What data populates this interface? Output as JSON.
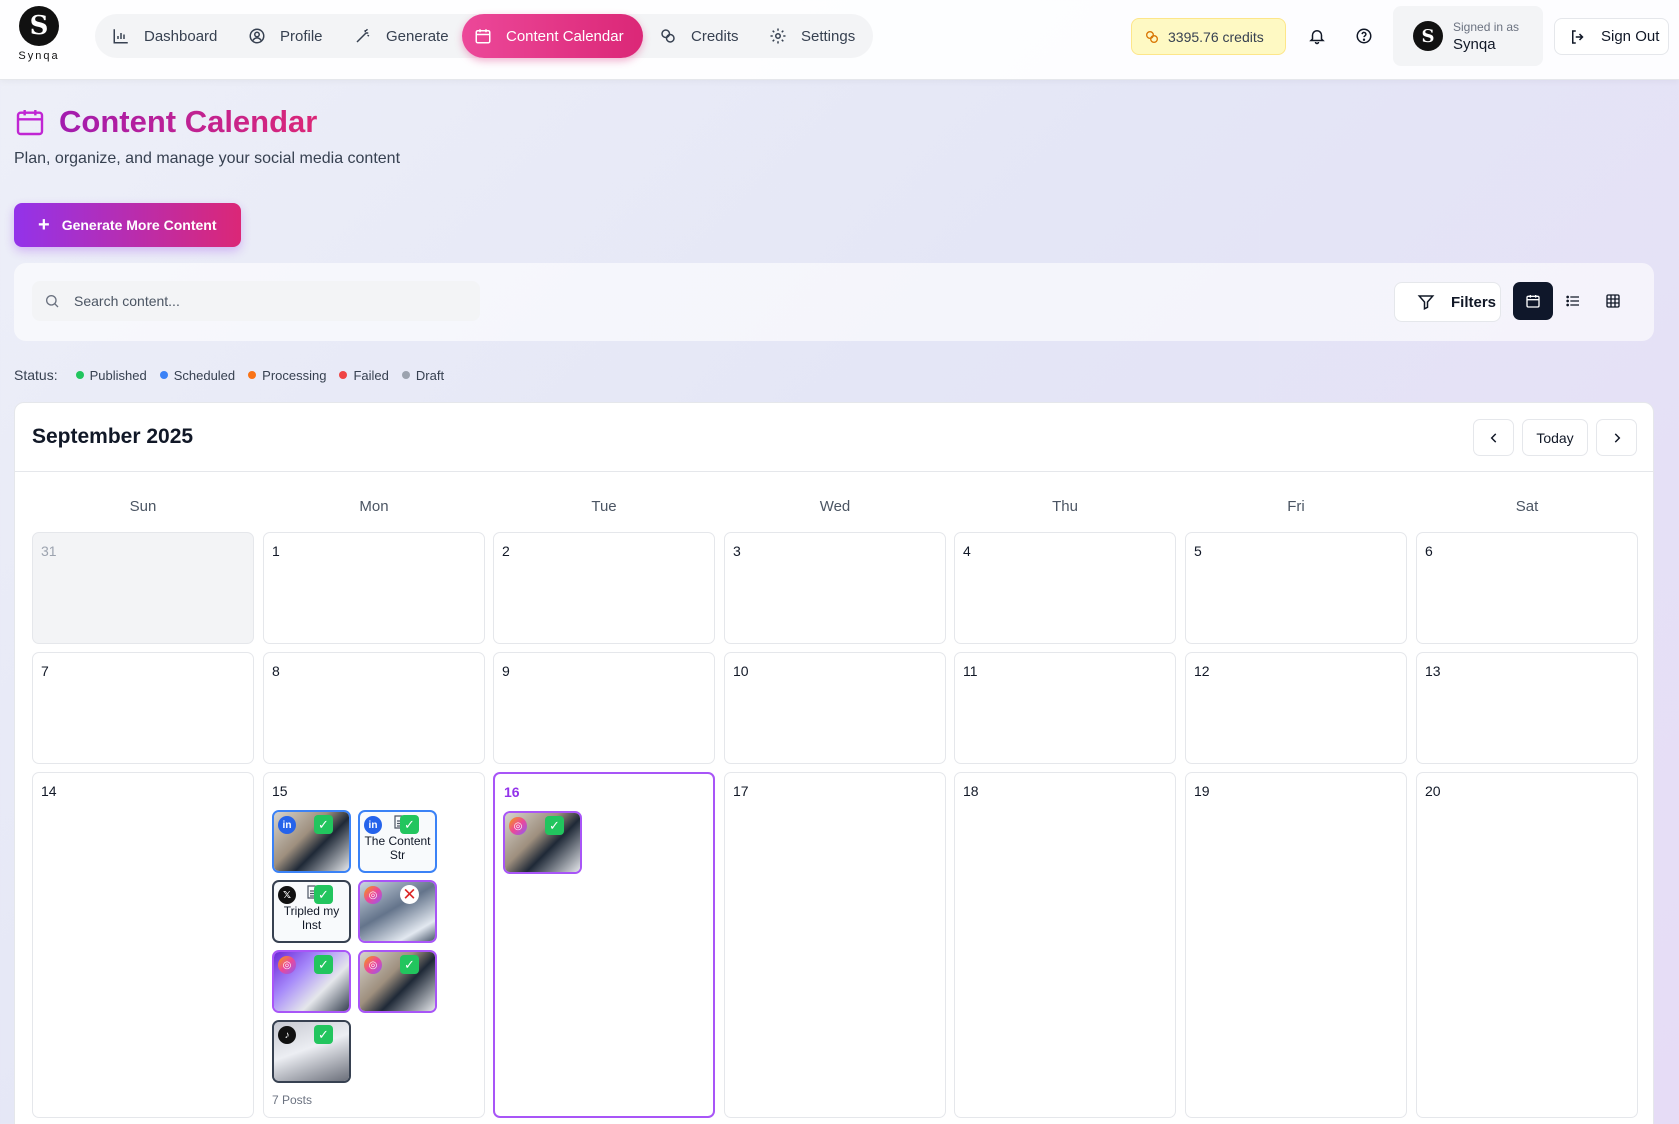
{
  "brand": {
    "name": "Synqa"
  },
  "nav": {
    "items": [
      {
        "label": "Dashboard",
        "icon": "bar-chart-icon"
      },
      {
        "label": "Profile",
        "icon": "user-circle-icon"
      },
      {
        "label": "Generate",
        "icon": "magic-wand-icon"
      },
      {
        "label": "Content Calendar",
        "icon": "calendar-icon",
        "active": true
      },
      {
        "label": "Credits",
        "icon": "coins-icon"
      },
      {
        "label": "Settings",
        "icon": "gear-icon"
      }
    ]
  },
  "header": {
    "credits": "3395.76 credits",
    "signed_in_label": "Signed in as",
    "user_name": "Synqa",
    "sign_out": "Sign Out"
  },
  "page": {
    "title": "Content Calendar",
    "subtitle": "Plan, organize, and manage your social media content",
    "generate_button": "Generate More Content"
  },
  "toolbar": {
    "search_placeholder": "Search content...",
    "filters_label": "Filters",
    "views": [
      "calendar-view",
      "list-view",
      "grid-view"
    ],
    "active_view": "calendar-view"
  },
  "legend": {
    "label": "Status:",
    "items": [
      {
        "label": "Published",
        "color": "#22c55e"
      },
      {
        "label": "Scheduled",
        "color": "#3b82f6"
      },
      {
        "label": "Processing",
        "color": "#f97316"
      },
      {
        "label": "Failed",
        "color": "#ef4444"
      },
      {
        "label": "Draft",
        "color": "#9ca3af"
      }
    ]
  },
  "calendar": {
    "month_title": "September 2025",
    "today_label": "Today",
    "weekdays": [
      "Sun",
      "Mon",
      "Tue",
      "Wed",
      "Thu",
      "Fri",
      "Sat"
    ],
    "weeks": [
      [
        "31",
        "1",
        "2",
        "3",
        "4",
        "5",
        "6"
      ],
      [
        "7",
        "8",
        "9",
        "10",
        "11",
        "12",
        "13"
      ],
      [
        "14",
        "15",
        "16",
        "17",
        "18",
        "19",
        "20"
      ]
    ],
    "outside_days": [
      "31"
    ],
    "today": "16",
    "posts": {
      "15": {
        "count_label": "7 Posts",
        "items": [
          {
            "platform": "linkedin",
            "type": "image",
            "status": "published"
          },
          {
            "platform": "linkedin",
            "type": "text",
            "text": "The Content Str",
            "status": "published"
          },
          {
            "platform": "x",
            "type": "text",
            "text": "Tripled my Inst",
            "status": "published"
          },
          {
            "platform": "instagram",
            "type": "image",
            "status": "failed"
          },
          {
            "platform": "instagram",
            "type": "image",
            "status": "published"
          },
          {
            "platform": "instagram",
            "type": "image",
            "status": "published"
          },
          {
            "platform": "tiktok",
            "type": "image",
            "status": "published"
          }
        ]
      },
      "16": {
        "items": [
          {
            "platform": "instagram",
            "type": "image",
            "status": "published"
          }
        ]
      }
    }
  },
  "colors": {
    "accent_pink": "#db2777",
    "accent_purple": "#9333ea",
    "today_border": "#a855f7"
  }
}
